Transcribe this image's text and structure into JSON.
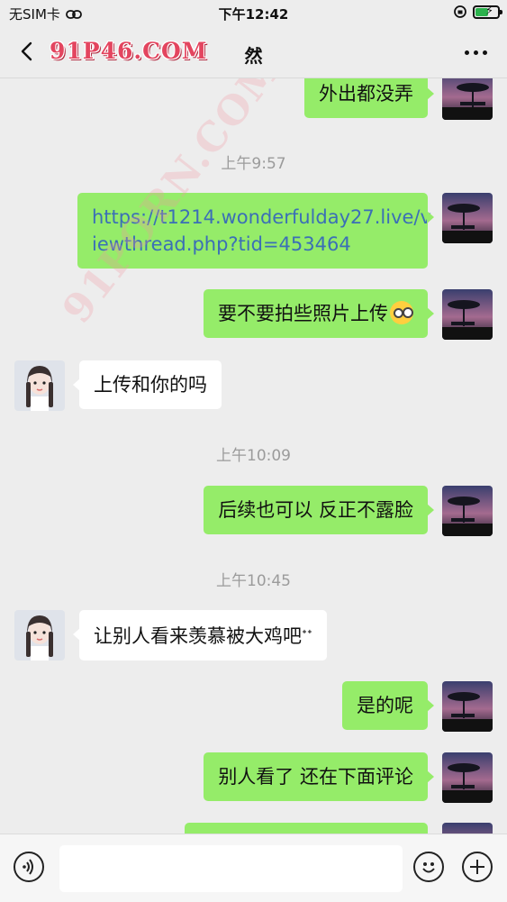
{
  "status_bar": {
    "carrier": "无SIM卡",
    "time": "下午12:42",
    "battery_charging": true
  },
  "nav": {
    "back_icon": "chevron-left-icon",
    "brand": "91P46.COM",
    "title": "然",
    "more_icon": "more-dots-icon"
  },
  "watermark": "91PORN.COM",
  "messages": [
    {
      "dir": "out",
      "text": "外出都没弄"
    },
    {
      "type": "time",
      "text": "上午9:57"
    },
    {
      "dir": "out",
      "line1": "https://t1214.wonderfulday27.live/v",
      "line2": "iewthread.php?tid=453464",
      "is_link": true
    },
    {
      "dir": "out",
      "text": "要不要拍些照片上传",
      "emoji": "face-with-monocle-emoji"
    },
    {
      "dir": "in",
      "text": "上传和你的吗"
    },
    {
      "type": "time",
      "text": "上午10:09"
    },
    {
      "dir": "out",
      "text": "后续也可以 反正不露脸"
    },
    {
      "type": "time",
      "text": "上午10:45"
    },
    {
      "dir": "in",
      "text": "让别人看来羡慕被大鸡吧"
    },
    {
      "dir": "out",
      "text": "是的呢"
    },
    {
      "dir": "out",
      "text": "别人看了 还在下面评论"
    }
  ],
  "input_bar": {
    "voice_icon": "voice-icon",
    "text_value": "",
    "emoji_icon": "smile-icon",
    "plus_icon": "plus-icon"
  },
  "colors": {
    "sent_bubble": "#95ec69",
    "received_bubble": "#ffffff",
    "background": "#ededed",
    "link": "#3b6fb6",
    "brand": "#e3455f"
  }
}
